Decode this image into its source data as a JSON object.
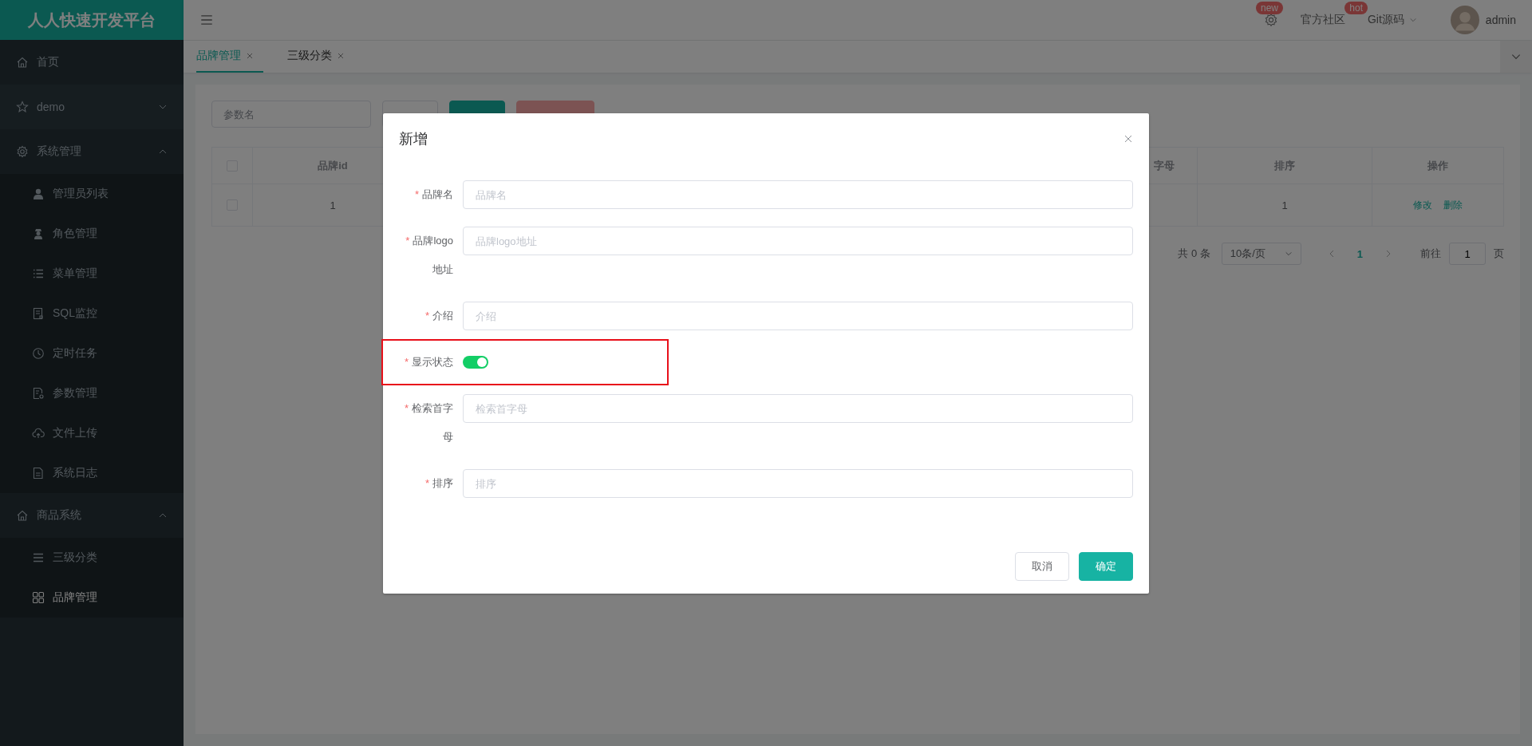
{
  "logo": "人人快速开发平台",
  "header": {
    "items": [
      {
        "kind": "icon",
        "badge": "new"
      },
      {
        "kind": "link",
        "label": "官方社区",
        "badge": "hot"
      },
      {
        "kind": "dropdown",
        "label": "Git源码"
      }
    ],
    "user": "admin"
  },
  "sidebar": [
    {
      "label": "首页",
      "selected": false
    },
    {
      "label": "demo",
      "selected": false,
      "expanded": false
    },
    {
      "label": "系统管理",
      "selected": false,
      "expanded": true,
      "children": [
        {
          "label": "管理员列表",
          "selected": false
        },
        {
          "label": "角色管理",
          "selected": false
        },
        {
          "label": "菜单管理",
          "selected": false
        },
        {
          "label": "SQL监控",
          "selected": false
        },
        {
          "label": "定时任务",
          "selected": false
        },
        {
          "label": "参数管理",
          "selected": false
        },
        {
          "label": "文件上传",
          "selected": false
        },
        {
          "label": "系统日志",
          "selected": false
        }
      ]
    },
    {
      "label": "商品系统",
      "selected": false,
      "expanded": true,
      "children": [
        {
          "label": "三级分类",
          "selected": false
        },
        {
          "label": "品牌管理",
          "selected": true
        }
      ]
    }
  ],
  "tabs": [
    {
      "label": "品牌管理",
      "selected": true
    },
    {
      "label": "三级分类",
      "selected": false
    }
  ],
  "toolbar": {
    "search_placeholder": "参数名",
    "buttons": [
      {
        "kind": "default"
      },
      {
        "kind": "primary"
      },
      {
        "kind": "danger"
      }
    ]
  },
  "table": {
    "header_checked": false,
    "columns": [
      "品牌id",
      "字母",
      "排序",
      "操作"
    ],
    "rows": [
      {
        "checked": false,
        "cells": [
          "1",
          "",
          "1"
        ],
        "actions": [
          "修改",
          "删除"
        ]
      }
    ]
  },
  "pagination": {
    "total": "共 0 条",
    "page_size": "10条/页",
    "pages": [
      {
        "label": "1",
        "selected": true
      }
    ],
    "goto_label": "前往",
    "goto_value": "1",
    "goto_suffix": "页"
  },
  "dialog": {
    "title": "新增",
    "fields": [
      {
        "kind": "text",
        "required_mark": "*",
        "label": "品牌名",
        "placeholder": "品牌名"
      },
      {
        "kind": "text",
        "required_mark": "*",
        "label": "品牌logo地址",
        "placeholder": "品牌logo地址"
      },
      {
        "kind": "text",
        "required_mark": "*",
        "label": "介绍",
        "placeholder": "介绍"
      },
      {
        "kind": "switch",
        "required_mark": "*",
        "label": "显示状态",
        "on": true
      },
      {
        "kind": "text",
        "required_mark": "*",
        "label": "检索首字母",
        "placeholder": "检索首字母"
      },
      {
        "kind": "text",
        "required_mark": "*",
        "label": "排序",
        "placeholder": "排序"
      }
    ],
    "buttons": [
      {
        "kind": "default",
        "label": "取消"
      },
      {
        "kind": "primary",
        "label": "确定"
      }
    ]
  }
}
